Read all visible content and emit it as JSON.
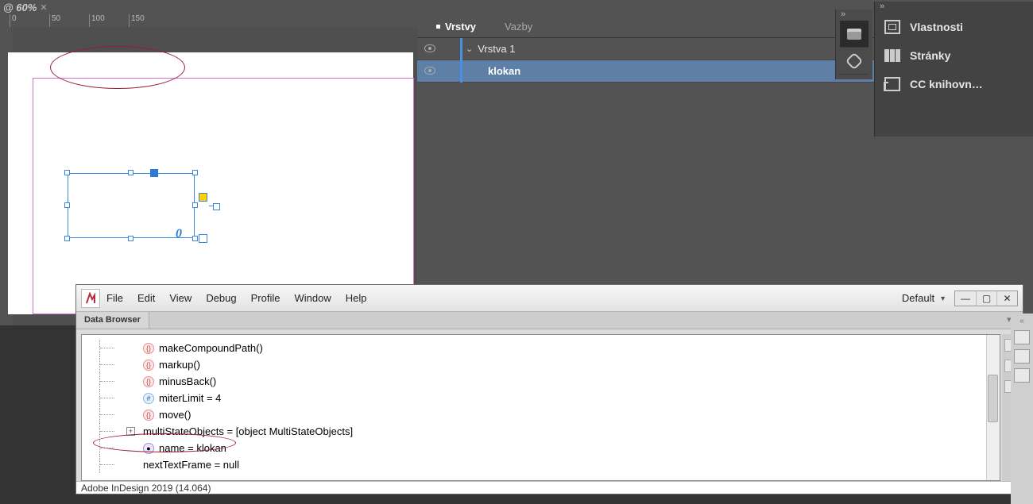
{
  "zoom_label": "@ 60%",
  "ruler_marks": [
    "0",
    "50",
    "100",
    "150"
  ],
  "panels": {
    "tabs": {
      "layers": "Vrstvy",
      "links": "Vazby"
    },
    "layer_name": "Vrstva 1",
    "object_name": "klokan"
  },
  "canvas": {
    "rotation_glyph": "0"
  },
  "dock": {
    "items": {
      "properties": "Vlastnosti",
      "pages": "Stránky",
      "cc_libs": "CC knihovn…"
    }
  },
  "estk": {
    "menu": {
      "file": "File",
      "edit": "Edit",
      "view": "View",
      "debug": "Debug",
      "profile": "Profile",
      "window": "Window",
      "help": "Help"
    },
    "workspace": "Default",
    "tab_label": "Data Browser",
    "tree_rows": [
      {
        "kind": "fn",
        "text": "makeCompoundPath()"
      },
      {
        "kind": "fn",
        "text": "markup()"
      },
      {
        "kind": "fn",
        "text": "minusBack()"
      },
      {
        "kind": "num",
        "text": "miterLimit = 4"
      },
      {
        "kind": "fn",
        "text": "move()"
      },
      {
        "kind": "obj",
        "expandable": true,
        "text": "multiStateObjects = [object MultiStateObjects]"
      },
      {
        "kind": "prop",
        "text": "name = klokan"
      },
      {
        "kind": "obj",
        "text": "nextTextFrame = null"
      }
    ],
    "status": "Adobe InDesign 2019 (14.064)"
  }
}
